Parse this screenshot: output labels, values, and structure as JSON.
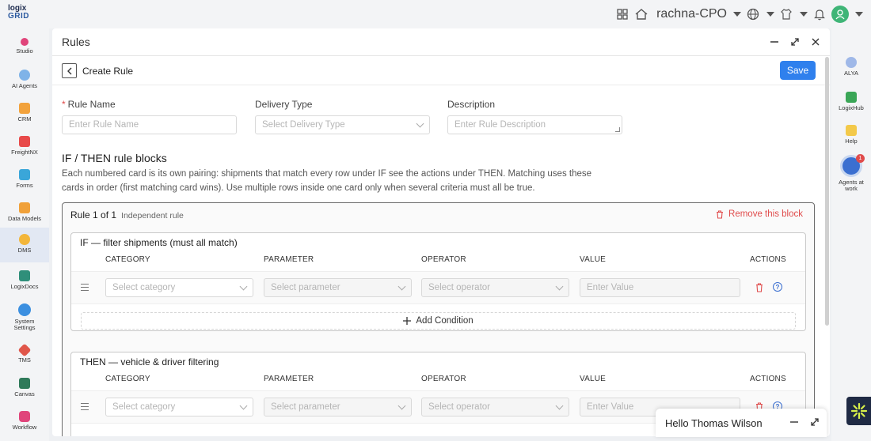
{
  "app": {
    "logo_line1": "logix",
    "logo_line2": "GRID",
    "user_name": "rachna-CPO"
  },
  "sidebar": {
    "items": [
      {
        "label": "Studio",
        "color": "#e0457b"
      },
      {
        "label": "AI Agents",
        "color": "#7fb3e8"
      },
      {
        "label": "CRM",
        "color": "#f2a23c"
      },
      {
        "label": "FreightNX",
        "color": "#e84a4a"
      },
      {
        "label": "Forms",
        "color": "#3aa6d9"
      },
      {
        "label": "Data Models",
        "color": "#f0a13a"
      },
      {
        "label": "DMS",
        "color": "#f3b63a"
      },
      {
        "label": "LogixDocs",
        "color": "#2f8f7a"
      },
      {
        "label": "System Settings",
        "color": "#3b8fe0"
      },
      {
        "label": "TMS",
        "color": "#e0564a"
      },
      {
        "label": "Canvas",
        "color": "#2f7a5a"
      },
      {
        "label": "Workflow",
        "color": "#e0457b"
      }
    ],
    "active": "DMS"
  },
  "rightbar": {
    "items": [
      {
        "label": "ALYA"
      },
      {
        "label": "LogixHub"
      },
      {
        "label": "Help"
      },
      {
        "label": "Agents at work",
        "badge": "1"
      }
    ]
  },
  "panel": {
    "title": "Rules"
  },
  "subheader": {
    "title": "Create Rule",
    "save_label": "Save"
  },
  "form": {
    "rule_name_required": "*",
    "rule_name_label": "Rule Name",
    "rule_name_placeholder": "Enter Rule Name",
    "delivery_type_label": "Delivery Type",
    "delivery_type_placeholder": "Select Delivery Type",
    "description_label": "Description",
    "description_placeholder": "Enter Rule Description"
  },
  "blocks": {
    "title": "IF / THEN rule blocks",
    "description": "Each numbered card is its own pairing: shipments that match every row under IF see the actions under THEN. Matching uses these cards in order (first matching card wins). Use multiple rows inside one card only when several criteria must all be true."
  },
  "rule": {
    "heading": "Rule 1 of 1",
    "subheading": "Independent rule",
    "remove_label": "Remove this block",
    "if_title": "IF — filter shipments (must all match)",
    "then_title": "THEN — vehicle & driver filtering",
    "columns": [
      "CATEGORY",
      "PARAMETER",
      "OPERATOR",
      "VALUE",
      "ACTIONS"
    ],
    "row_placeholders": {
      "category": "Select category",
      "parameter": "Select parameter",
      "operator": "Select operator",
      "value": "Enter Value"
    },
    "add_condition_label": "Add Condition"
  },
  "chat": {
    "greeting": "Hello Thomas Wilson"
  },
  "colors": {
    "accent": "#2f80ed",
    "danger": "#e04b4b"
  }
}
